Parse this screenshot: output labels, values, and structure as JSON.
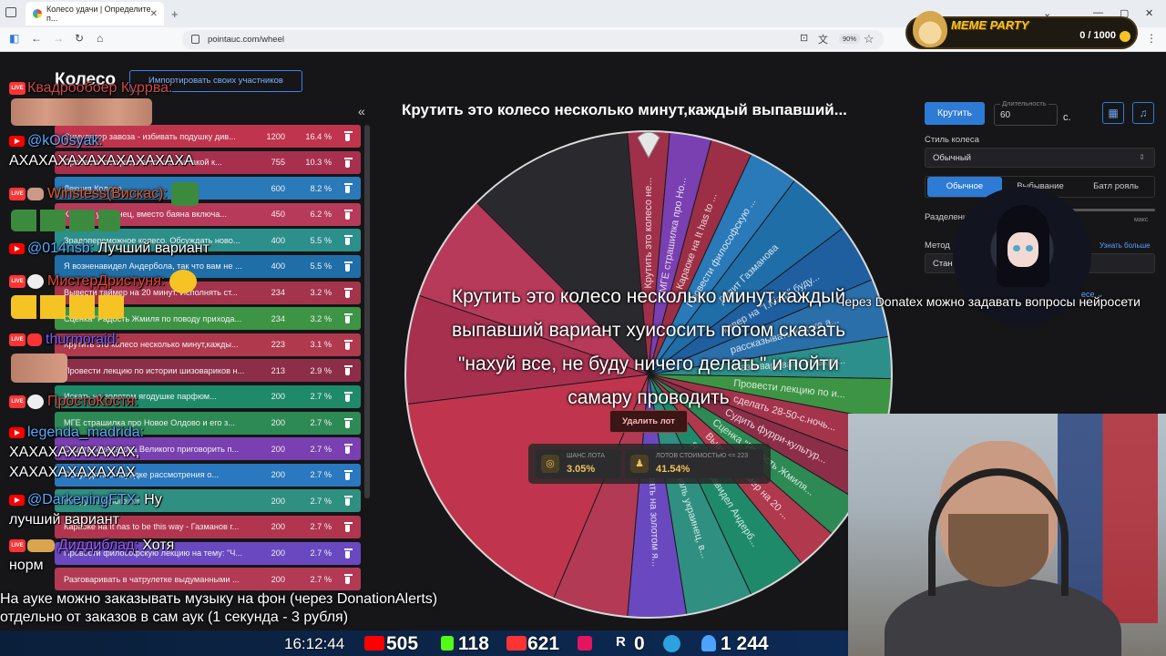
{
  "browser": {
    "tab_title": "Колесо удачи | Определите п...",
    "url": "pointauc.com/wheel",
    "zoom": "90%"
  },
  "meme_party": {
    "title": "MEME PARTY",
    "value": "0 / 1000"
  },
  "page": {
    "title": "Колесо",
    "import_button": "Импортировать своих участников",
    "collapse": "«"
  },
  "lots": [
    {
      "name": "Симулятор завоза - избивать подушку див...",
      "value": "1200",
      "percent": "16.4 %",
      "color": "#c0354d"
    },
    {
      "name": "Провести лекцию, на что же он такой к...",
      "value": "755",
      "percent": "10.3 %",
      "color": "#a8304f"
    },
    {
      "name": "Лекция Колесо...",
      "value": "600",
      "percent": "8.2 %",
      "color": "#2a79b8"
    },
    {
      "name": "Кашоль украинец, вместо баяна включа...",
      "value": "450",
      "percent": "6.2 %",
      "color": "#b83a5a"
    },
    {
      "name": "Зрадопереможное колесо. Обсуждать ново...",
      "value": "400",
      "percent": "5.5 %",
      "color": "#2c8f8c"
    },
    {
      "name": "Я возненавидел Андербола, так что вам не ...",
      "value": "400",
      "percent": "5.5 %",
      "color": "#1f6ea8"
    },
    {
      "name": "Вывести таймер на 20 минут. Исполнять ст...",
      "value": "234",
      "percent": "3.2 %",
      "color": "#a3344c"
    },
    {
      "name": "Сценка \"Радость Жмиля по поводу прихода...",
      "value": "234",
      "percent": "3.2 %",
      "color": "#3d9444"
    },
    {
      "name": "Крутить это колесо несколько минут,кажды...",
      "value": "223",
      "percent": "3.1 %",
      "color": "#b0394e"
    },
    {
      "name": "Провести лекцию по истории шизовариков н...",
      "value": "213",
      "percent": "2.9 %",
      "color": "#8c2e48"
    },
    {
      "name": "Искать на золотом ягодушке парфюм...",
      "value": "200",
      "percent": "2.7 %",
      "color": "#1f8a6a"
    },
    {
      "name": "МГЕ страшилка про Новое Олдово и его з...",
      "value": "200",
      "percent": "2.7 %",
      "color": "#2e8a55"
    },
    {
      "name": "Судить Мандатова Великого приговорить п...",
      "value": "200",
      "percent": "2.7 %",
      "color": "#7a3fb0"
    },
    {
      "name": "Обсуждать о порядке рассмотрения о...",
      "value": "200",
      "percent": "2.7 %",
      "color": "#2a78c0"
    },
    {
      "name": "Кот ру... аудиогости",
      "value": "200",
      "percent": "2.7 %",
      "color": "#2f8f80"
    },
    {
      "name": "Караоке на It has to be this way - Газманов г...",
      "value": "200",
      "percent": "2.7 %",
      "color": "#b2354f"
    },
    {
      "name": "Провести философскую лекцию на тему: \"Ч...",
      "value": "200",
      "percent": "2.7 %",
      "color": "#6a49c0"
    },
    {
      "name": "Разговаривать в чатрулетке выдуманными ...",
      "value": "200",
      "percent": "2.7 %",
      "color": "#b23a55"
    }
  ],
  "wheel": {
    "title": "Крутить это колесо несколько минут,каждый выпавший...",
    "caption_lines": [
      "Крутить это колесо несколько минут,каждый",
      "выпавший вариант хуисосить потом сказать",
      "\"нахуй все, не буду ничего делать\" и пойти",
      "самару проводить"
    ],
    "delete_button": "Удалить лот",
    "chance_label": "ШАНС ЛОТА",
    "chance_value": "3.05%",
    "lots_label": "ЛОТОВ СТОИМОСТЬЮ <= 223",
    "lots_value": "41.54%",
    "segment_labels": [
      "Крутить это колесо не...",
      "МГЕ страшилка про Но...",
      "Караоке на It has to ...",
      "Провести философскую ...",
      "Дудит Газманова",
      "кавер на \"I.Kiaф\" буду...",
      "рассказывать как же а...",
      "Разговаривать в чатру...",
      "Провести лекцию по и...",
      "сделать 28-50-с.ночь...",
      "Судить фурри-культур...",
      "Сценка \"Радость Жмиля...",
      "Вывести таймер на 20 ...",
      "Я возненавидел Андерб...",
      "Кашоль украинец, в...",
      "искать на золотом я..."
    ]
  },
  "controls": {
    "spin_button": "Крутить",
    "duration_label": "Длительность",
    "duration_value": "60",
    "duration_unit": "с.",
    "style_label": "Стиль колеса",
    "style_value": "Обычный",
    "modes": [
      "Обычное",
      "Выбывание",
      "Батл рояль"
    ],
    "separator_label": "Разделение",
    "max_label": "макс",
    "method_label": "Метод",
    "learn_more": "Узнать больше",
    "method_value": "Стан",
    "more_link": "есе"
  },
  "chat": {
    "messages": [
      {
        "user": "Квадрообоер Куррва:",
        "text": "",
        "user_color": "#cf4848"
      },
      {
        "user": "@kO0syak:",
        "text": "",
        "user_color": "#5aa9ff"
      },
      {
        "user": "",
        "text": "АХАХАХАХАХАХАХАХАХА",
        "user_color": "#fff"
      },
      {
        "user": "Winstess(Вискас):",
        "text": "",
        "user_color": "#e05a2a"
      },
      {
        "user": "@014nsb:",
        "text": "Лучший вариант",
        "user_color": "#5aa9ff"
      },
      {
        "user": "МистерДристуня:",
        "text": "",
        "user_color": "#e0493b"
      },
      {
        "user": "thurmoraid:",
        "text": "",
        "user_color": "#7a5cff"
      },
      {
        "user": "ПростоКостя:",
        "text": "",
        "user_color": "#d94a4a"
      },
      {
        "user": "legenda_madrida:",
        "text": "",
        "user_color": "#5aa9ff"
      },
      {
        "user": "",
        "text": "ХАХАХАХАХАХАХ,",
        "user_color": "#fff"
      },
      {
        "user": "",
        "text": "ХАХАХАХАХАХАХ",
        "user_color": "#fff"
      },
      {
        "user": "@DarkeningFTX:",
        "text": "Ну",
        "user_color": "#5aa9ff"
      },
      {
        "user": "",
        "text": "лучший вариант",
        "user_color": "#fff"
      },
      {
        "user": "Диддиблад:",
        "text": "Хотя",
        "user_color": "#9b5cff"
      },
      {
        "user": "",
        "text": "норм",
        "user_color": "#fff"
      }
    ]
  },
  "overlay": {
    "donatex": "Через Donatex можно задавать вопросы нейросети",
    "bottom_line1": "На ауке можно заказывать музыку на фон (через DonationAlerts)",
    "bottom_line2": "отдельно от заказов в сам аук (1 секунда - 3 рубля)"
  },
  "statsbar": {
    "clock": "16:12:44",
    "youtube": "505",
    "kick": "118",
    "live": "621",
    "rutube": "0",
    "telegram": "",
    "viewers": "1 244"
  }
}
